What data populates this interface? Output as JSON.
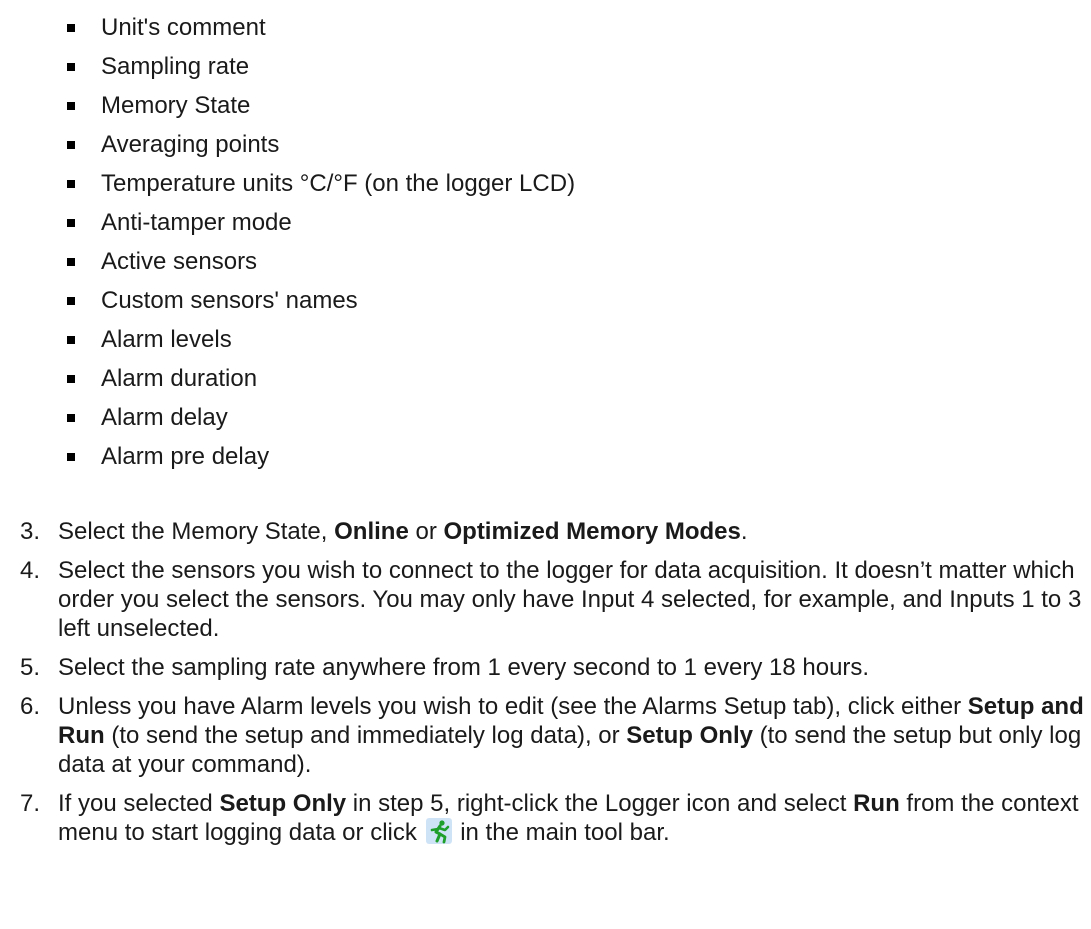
{
  "bullets": [
    "Unit's comment",
    "Sampling rate",
    "Memory State",
    "Averaging points",
    "Temperature units °C/°F (on the logger LCD)",
    "Anti-tamper mode",
    "Active sensors",
    "Custom sensors' names",
    "Alarm levels",
    "Alarm duration",
    "Alarm delay",
    "Alarm pre delay"
  ],
  "steps": [
    {
      "number": "3.",
      "parts": [
        {
          "text": "Select the Memory State, ",
          "bold": false
        },
        {
          "text": "Online",
          "bold": true
        },
        {
          "text": " or ",
          "bold": false
        },
        {
          "text": "Optimized Memory Modes",
          "bold": true
        },
        {
          "text": ".",
          "bold": false
        }
      ]
    },
    {
      "number": "4.",
      "parts": [
        {
          "text": "Select the sensors you wish to connect to the logger for data acquisition. It doesn’t matter which order you select the sensors. You may only have Input 4 selected, for example, and Inputs 1 to 3 left unselected.",
          "bold": false
        }
      ]
    },
    {
      "number": "5.",
      "parts": [
        {
          "text": "Select the sampling rate anywhere from 1 every second to 1 every 18 hours.",
          "bold": false
        }
      ]
    },
    {
      "number": "6.",
      "parts": [
        {
          "text": "Unless you have Alarm levels you wish to edit (see the Alarms Setup tab), click either ",
          "bold": false
        },
        {
          "text": "Setup and Run",
          "bold": true
        },
        {
          "text": " (to send the setup and immediately log data), or ",
          "bold": false
        },
        {
          "text": "Setup Only",
          "bold": true
        },
        {
          "text": " (to send the setup but only log data at your command).",
          "bold": false
        }
      ]
    },
    {
      "number": "7.",
      "parts": [
        {
          "text": "If you selected ",
          "bold": false
        },
        {
          "text": "Setup Only",
          "bold": true
        },
        {
          "text": " in step 5, right-click the Logger icon and select ",
          "bold": false
        },
        {
          "text": "Run",
          "bold": true
        },
        {
          "text": " from the context menu to start logging data or click ",
          "bold": false
        },
        {
          "icon": "run-icon"
        },
        {
          "text": " in the main tool bar.",
          "bold": false
        }
      ]
    }
  ]
}
